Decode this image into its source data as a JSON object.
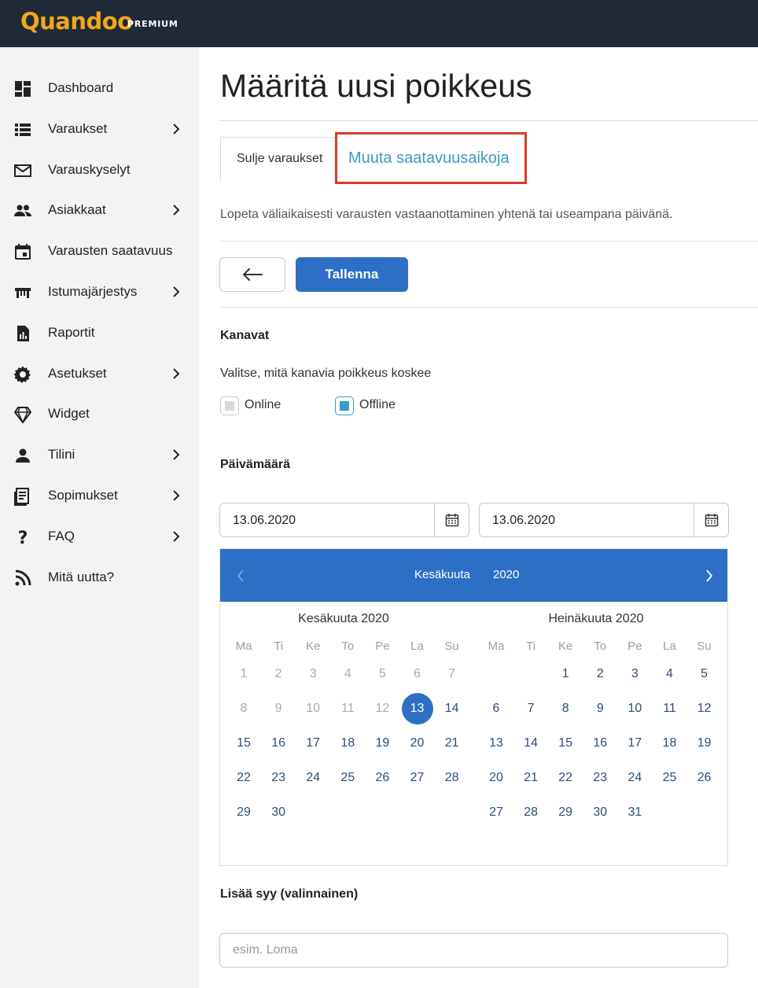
{
  "brand": {
    "logo": "Quandoo",
    "tier": "PREMIUM",
    "logo_color": "#f0a81c",
    "topbar_color": "#1f2a36"
  },
  "sidebar": {
    "items": [
      {
        "label": "Dashboard",
        "icon": "dashboard-icon",
        "has_submenu": false
      },
      {
        "label": "Varaukset",
        "icon": "list-icon",
        "has_submenu": true
      },
      {
        "label": "Varauskyselyt",
        "icon": "mail-icon",
        "has_submenu": false
      },
      {
        "label": "Asiakkaat",
        "icon": "people-icon",
        "has_submenu": true
      },
      {
        "label": "Varausten saatavuus",
        "icon": "calendar-icon",
        "has_submenu": false
      },
      {
        "label": "Istumajärjestys",
        "icon": "table-icon",
        "has_submenu": true
      },
      {
        "label": "Raportit",
        "icon": "report-icon",
        "has_submenu": false
      },
      {
        "label": "Asetukset",
        "icon": "gear-icon",
        "has_submenu": true
      },
      {
        "label": "Widget",
        "icon": "diamond-icon",
        "has_submenu": false
      },
      {
        "label": "Tilini",
        "icon": "person-icon",
        "has_submenu": true
      },
      {
        "label": "Sopimukset",
        "icon": "document-icon",
        "has_submenu": true
      },
      {
        "label": "FAQ",
        "icon": "question-icon",
        "has_submenu": true
      },
      {
        "label": "Mitä uutta?",
        "icon": "rss-icon",
        "has_submenu": false
      }
    ]
  },
  "page": {
    "title": "Määritä uusi poikkeus"
  },
  "tabs": {
    "close_bookings": "Sulje varaukset",
    "change_availability": "Muuta saatavuusaikoja"
  },
  "description": "Lopeta väliaikaisesti varausten vastaanottaminen yhtenä tai useampana päivänä.",
  "actions": {
    "back_icon": "arrow-left-icon",
    "save_label": "Tallenna",
    "accent_color": "#2d6fc4"
  },
  "channels": {
    "heading": "Kanavat",
    "subtext": "Valitse, mitä kanavia poikkeus koskee",
    "options": [
      {
        "label": "Online",
        "checked": false
      },
      {
        "label": "Offline",
        "checked": true
      }
    ]
  },
  "date": {
    "heading": "Päivämäärä",
    "start": "13.06.2020",
    "end": "13.06.2020",
    "picker": {
      "header_month": "Kesäkuuta",
      "header_year": "2020",
      "weekdays": [
        "Ma",
        "Ti",
        "Ke",
        "To",
        "Pe",
        "La",
        "Su"
      ],
      "months": [
        {
          "title": "Kesäkuuta 2020",
          "offset": 0,
          "days": 30,
          "disabled_through": 12,
          "selected": 13
        },
        {
          "title": "Heinäkuuta 2020",
          "offset": 2,
          "days": 31,
          "disabled_through": 0,
          "selected": null
        }
      ]
    }
  },
  "reason": {
    "label": "Lisää syy (valinnainen)",
    "placeholder": "esim. Loma"
  }
}
